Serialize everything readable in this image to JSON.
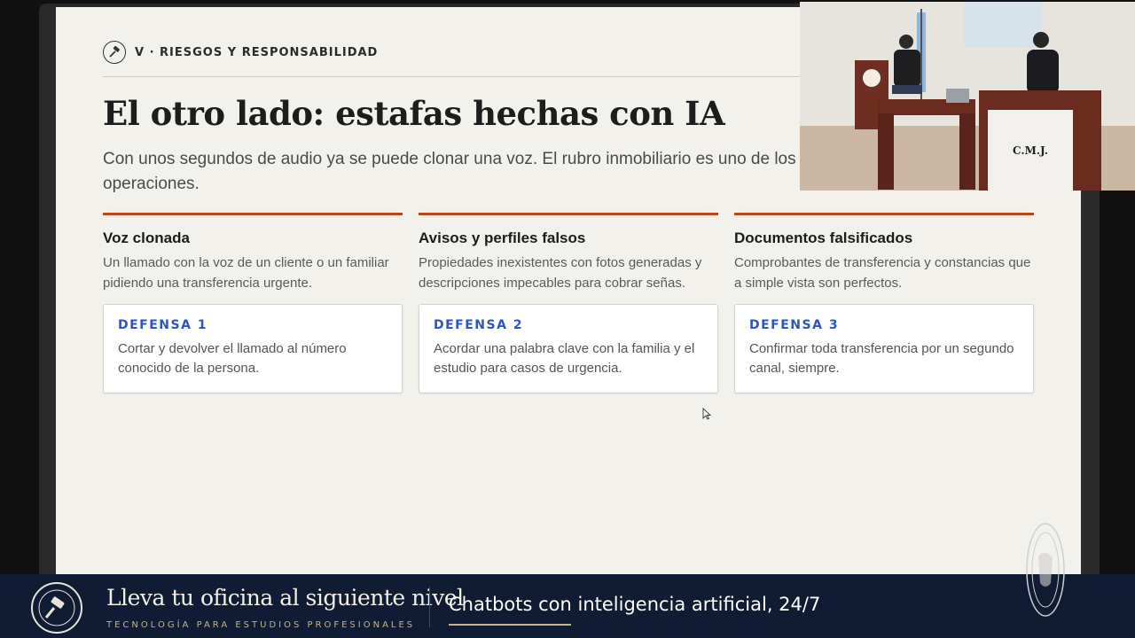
{
  "slide": {
    "section_label": "V · RIESGOS Y RESPONSABILIDAD",
    "title": "El otro lado: estafas hechas con IA",
    "subtitle": "Con unos segundos de audio ya se puede clonar una voz. El rubro inmobiliario es uno de los más el monto de las operaciones.",
    "columns": [
      {
        "heading": "Voz clonada",
        "description": "Un llamado con la voz de un cliente o un familiar pidiendo una transferencia urgente.",
        "defense_label": "DEFENSA 1",
        "defense_text": "Cortar y devolver el llamado al número conocido de la persona."
      },
      {
        "heading": "Avisos y perfiles falsos",
        "description": "Propiedades inexistentes con fotos generadas y descripciones impecables para cobrar señas.",
        "defense_label": "DEFENSA 2",
        "defense_text": "Acordar una palabra clave con la familia y el estudio para casos de urgencia."
      },
      {
        "heading": "Documentos falsificados",
        "description": "Comprobantes de transferencia y constancias que a simple vista son perfectos.",
        "defense_label": "DEFENSA 3",
        "defense_text": "Confirmar toda transferencia por un segundo canal, siempre."
      }
    ],
    "accent_color": "#b8481c",
    "defense_color": "#2f55b8"
  },
  "camera": {
    "podium_label": "C.M.J."
  },
  "banner": {
    "main_text": "Lleva tu oficina al siguiente nivel",
    "sub_text": "TECNOLOGÍA PARA ESTUDIOS PROFESIONALES",
    "ticker_text": "Chatbots con inteligencia artificial, 24/7",
    "background_color": "#0f1c33",
    "gold_color": "#c6b487"
  }
}
